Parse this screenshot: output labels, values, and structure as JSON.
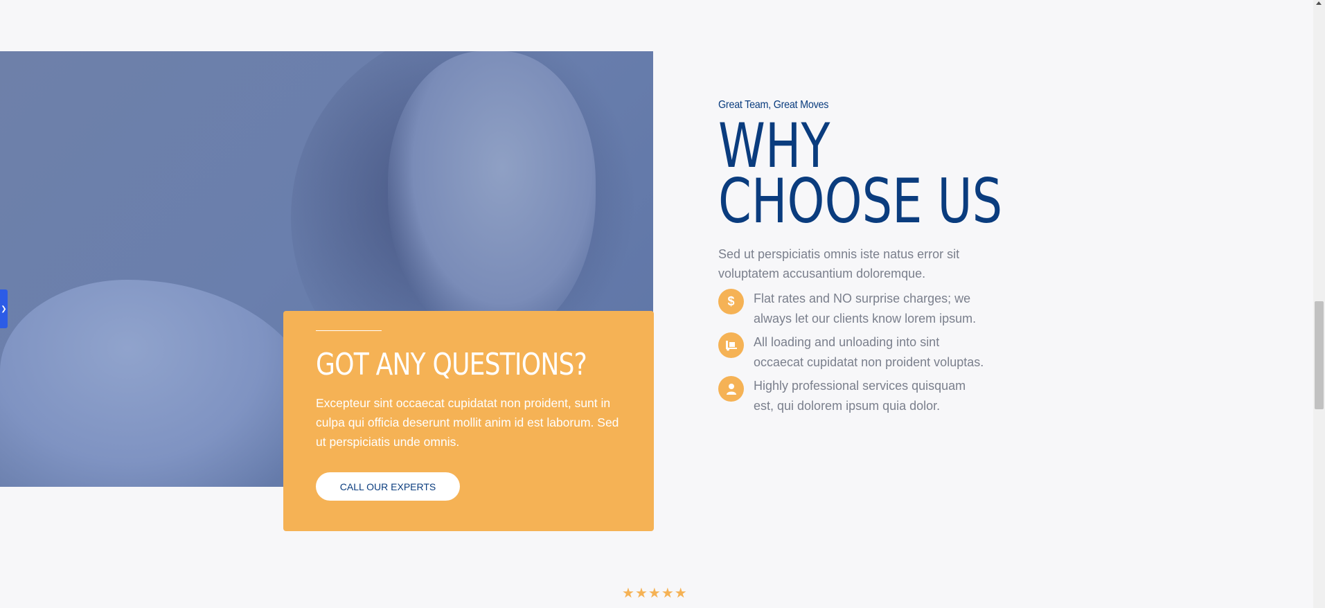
{
  "hero": {
    "image_description_icon": "woman-on-phone-photo"
  },
  "question_card": {
    "title": "GOT ANY QUESTIONS?",
    "body": "Excepteur sint occaecat cupidatat non proident, sunt in culpa qui officia deserunt mollit anim id est laborum. Sed ut perspiciatis unde omnis.",
    "cta_label": "CALL OUR EXPERTS"
  },
  "why": {
    "eyebrow": "Great Team, Great Moves",
    "title": "WHY CHOOSE US",
    "lead": "Sed ut perspiciatis omnis iste natus error sit voluptatem accusantium doloremque.",
    "items": [
      {
        "icon": "dollar-icon",
        "glyph": "$",
        "text": "Flat rates and NO surprise charges; we always let our clients know lorem ipsum."
      },
      {
        "icon": "truck-loading-icon",
        "glyph": "▥",
        "text": "All loading and unloading into sint occaecat cupidatat non proident voluptas."
      },
      {
        "icon": "user-tie-icon",
        "glyph": "●",
        "text": "Highly professional services quisquam est, qui dolorem ipsum quia dolor."
      }
    ]
  },
  "rating": {
    "stars": 5,
    "max": 5
  },
  "colors": {
    "accent": "#f5b255",
    "brand_blue": "#0a3c7e",
    "body_text": "#7a7f8c",
    "background": "#f7f7f9",
    "side_tab": "#2c5ce6"
  }
}
